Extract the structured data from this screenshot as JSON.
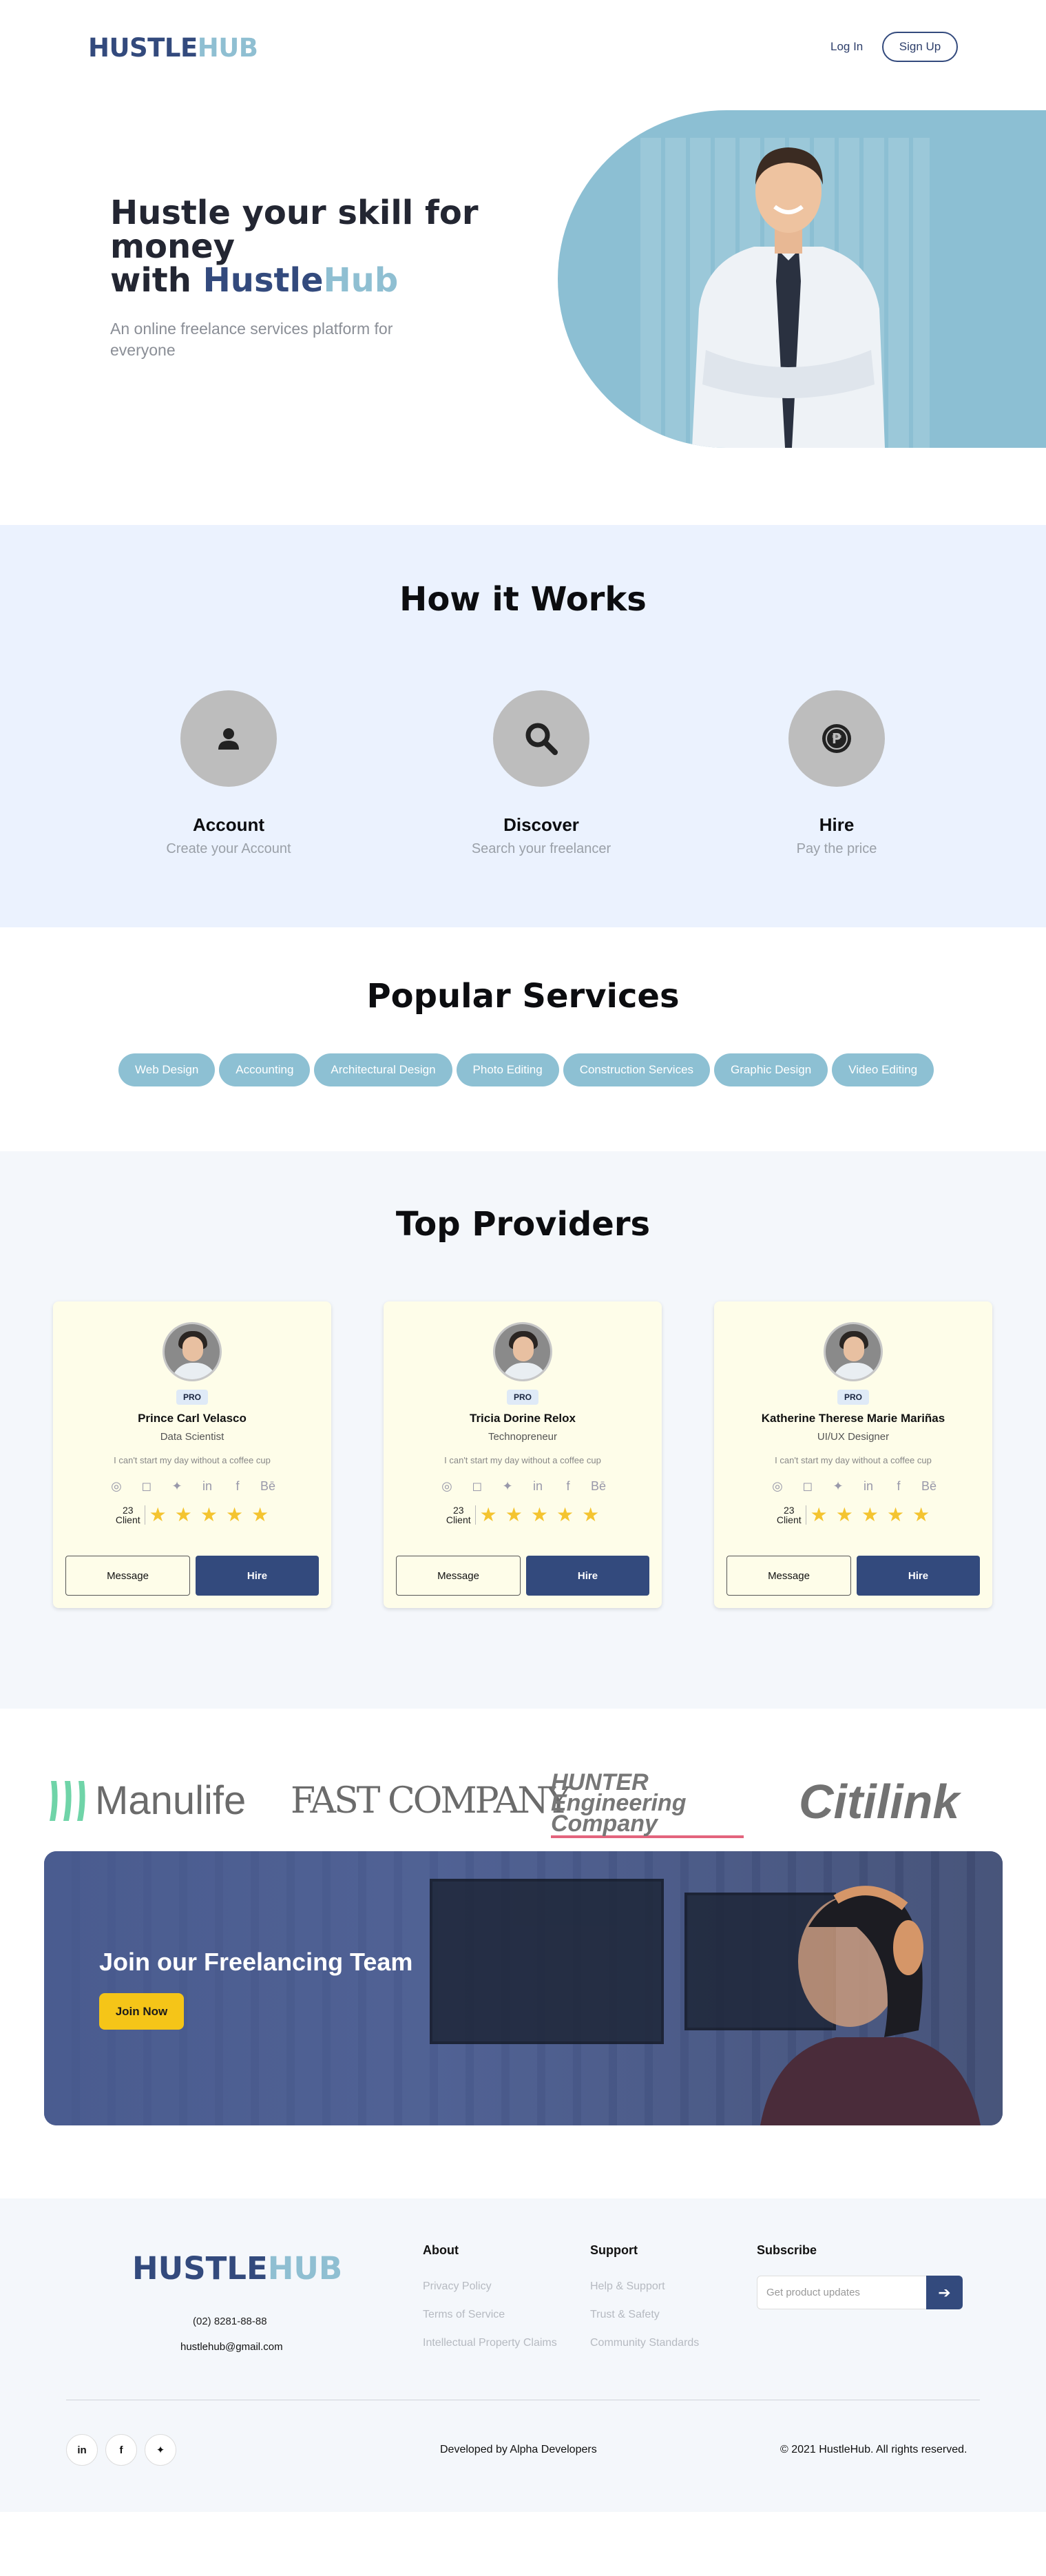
{
  "brand": {
    "part1": "HUSTLE",
    "part2": "HUB"
  },
  "nav": {
    "login": "Log In",
    "signup": "Sign Up"
  },
  "hero": {
    "line1": "Hustle your skill for",
    "line2": "money",
    "line3_prefix": "with ",
    "brand_part1": "Hustle",
    "brand_part2": "Hub",
    "subtitle": "An online freelance services platform for everyone"
  },
  "how": {
    "title": "How it Works",
    "steps": [
      {
        "title": "Account",
        "desc": "Create your Account",
        "icon": "user-icon"
      },
      {
        "title": "Discover",
        "desc": "Search your freelancer",
        "icon": "search-icon"
      },
      {
        "title": "Hire",
        "desc": "Pay the price",
        "icon": "peso-coin-icon"
      }
    ]
  },
  "services": {
    "title": "Popular Services",
    "items": [
      "Web Design",
      "Accounting",
      "Architectural Design",
      "Photo Editing",
      "Construction Services",
      "Graphic Design",
      "Video Editing"
    ]
  },
  "providers": {
    "title": "Top Providers",
    "cards": [
      {
        "badge": "PRO",
        "name": "Prince Carl Velasco",
        "role": "Data Scientist",
        "quote": "I can't start my day without a coffee cup",
        "clients_count": "23",
        "clients_label": "Client",
        "rating": 5,
        "message": "Message",
        "hire": "Hire"
      },
      {
        "badge": "PRO",
        "name": "Tricia Dorine Relox",
        "role": "Technopreneur",
        "quote": "I can't start my day without a coffee cup",
        "clients_count": "23",
        "clients_label": "Client",
        "rating": 5,
        "message": "Message",
        "hire": "Hire"
      },
      {
        "badge": "PRO",
        "name": "Katherine Therese Marie Mariñas",
        "role": "UI/UX Designer",
        "quote": "I can't start my day without a coffee cup",
        "clients_count": "23",
        "clients_label": "Client",
        "rating": 5,
        "message": "Message",
        "hire": "Hire"
      }
    ],
    "social_icons": [
      "dribbble-icon",
      "instagram-icon",
      "twitter-icon",
      "linkedin-icon",
      "facebook-icon",
      "behance-icon"
    ]
  },
  "partners": [
    "Manulife",
    "FAST COMPANY",
    "HUNTER Engineering Company",
    "Citilink"
  ],
  "join": {
    "title": "Join our Freelancing Team",
    "button": "Join Now"
  },
  "footer": {
    "phone": "(02) 8281-88-88",
    "email": "hustlehub@gmail.com",
    "about": {
      "title": "About",
      "links": [
        "Privacy Policy",
        "Terms of Service",
        "Intellectual Property Claims"
      ]
    },
    "support": {
      "title": "Support",
      "links": [
        "Help & Support",
        "Trust & Safety",
        "Community Standards"
      ]
    },
    "subscribe": {
      "title": "Subscribe",
      "placeholder": "Get product updates"
    },
    "developer": "Developed by Alpha Developers",
    "copyright": "© 2021 HustleHub. All rights reserved."
  },
  "colors": {
    "navy": "#334a7d",
    "sky": "#8dc0d3",
    "yellow": "#f5c518",
    "star": "#f4c430"
  }
}
